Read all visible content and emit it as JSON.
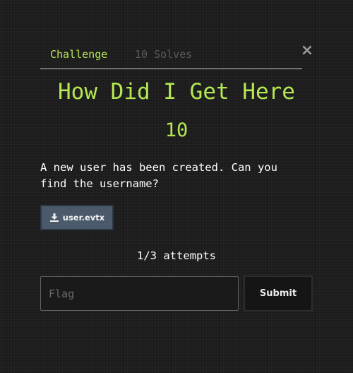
{
  "tabs": {
    "challenge_label": "Challenge",
    "solves_label": "10 Solves"
  },
  "close_icon": "close-icon",
  "challenge": {
    "title": "How Did I Get Here",
    "value": "10",
    "description": "A new user has been created. Can you find the username?"
  },
  "file": {
    "icon": "download-icon",
    "label": "user.evtx"
  },
  "attempts": "1/3 attempts",
  "flag": {
    "placeholder": "Flag",
    "value": ""
  },
  "submit_label": "Submit",
  "colors": {
    "accent": "#b5e853",
    "background": "#1c1c1c",
    "file_button": "#4a5a6a",
    "muted": "#5a5a5a"
  }
}
